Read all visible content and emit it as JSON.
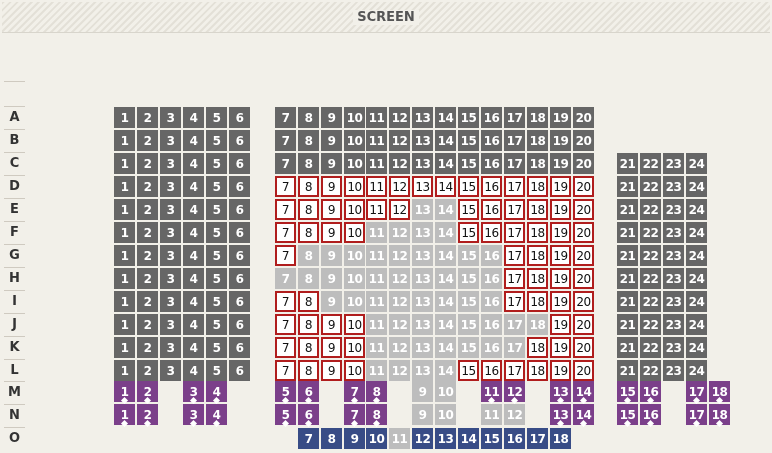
{
  "screen_label": "SCREEN",
  "row_labels": [
    "A",
    "B",
    "C",
    "D",
    "E",
    "F",
    "G",
    "H",
    "I",
    "J",
    "K",
    "L",
    "M",
    "N",
    "O"
  ],
  "legend_colors": {
    "taken": "#666666",
    "free_border": "#b01d1d",
    "blocked": "#bdbdbd",
    "special": "#7b3f8a",
    "blue": "#384c86"
  },
  "rows": [
    {
      "row": "A",
      "seats": [
        [
          "1",
          "taken"
        ],
        [
          "2",
          "taken"
        ],
        [
          "3",
          "taken"
        ],
        [
          "4",
          "taken"
        ],
        [
          "5",
          "taken"
        ],
        [
          "6",
          "taken"
        ],
        [
          "7",
          "taken"
        ],
        [
          "8",
          "taken"
        ],
        [
          "9",
          "taken"
        ],
        [
          "10",
          "taken"
        ],
        [
          "11",
          "taken"
        ],
        [
          "12",
          "taken"
        ],
        [
          "13",
          "taken"
        ],
        [
          "14",
          "taken"
        ],
        [
          "15",
          "taken"
        ],
        [
          "16",
          "taken"
        ],
        [
          "17",
          "taken"
        ],
        [
          "18",
          "taken"
        ],
        [
          "19",
          "taken"
        ],
        [
          "20",
          "taken"
        ]
      ]
    },
    {
      "row": "B",
      "seats": [
        [
          "1",
          "taken"
        ],
        [
          "2",
          "taken"
        ],
        [
          "3",
          "taken"
        ],
        [
          "4",
          "taken"
        ],
        [
          "5",
          "taken"
        ],
        [
          "6",
          "taken"
        ],
        [
          "7",
          "taken"
        ],
        [
          "8",
          "taken"
        ],
        [
          "9",
          "taken"
        ],
        [
          "10",
          "taken"
        ],
        [
          "11",
          "taken"
        ],
        [
          "12",
          "taken"
        ],
        [
          "13",
          "taken"
        ],
        [
          "14",
          "taken"
        ],
        [
          "15",
          "taken"
        ],
        [
          "16",
          "taken"
        ],
        [
          "17",
          "taken"
        ],
        [
          "18",
          "taken"
        ],
        [
          "19",
          "taken"
        ],
        [
          "20",
          "taken"
        ]
      ]
    },
    {
      "row": "C",
      "seats": [
        [
          "1",
          "taken"
        ],
        [
          "2",
          "taken"
        ],
        [
          "3",
          "taken"
        ],
        [
          "4",
          "taken"
        ],
        [
          "5",
          "taken"
        ],
        [
          "6",
          "taken"
        ],
        [
          "7",
          "taken"
        ],
        [
          "8",
          "taken"
        ],
        [
          "9",
          "taken"
        ],
        [
          "10",
          "taken"
        ],
        [
          "11",
          "taken"
        ],
        [
          "12",
          "taken"
        ],
        [
          "13",
          "taken"
        ],
        [
          "14",
          "taken"
        ],
        [
          "15",
          "taken"
        ],
        [
          "16",
          "taken"
        ],
        [
          "17",
          "taken"
        ],
        [
          "18",
          "taken"
        ],
        [
          "19",
          "taken"
        ],
        [
          "20",
          "taken"
        ],
        [
          "21",
          "taken"
        ],
        [
          "22",
          "taken"
        ],
        [
          "23",
          "taken"
        ],
        [
          "24",
          "taken"
        ]
      ]
    },
    {
      "row": "D",
      "seats": [
        [
          "1",
          "taken"
        ],
        [
          "2",
          "taken"
        ],
        [
          "3",
          "taken"
        ],
        [
          "4",
          "taken"
        ],
        [
          "5",
          "taken"
        ],
        [
          "6",
          "taken"
        ],
        [
          "7",
          "free"
        ],
        [
          "8",
          "free"
        ],
        [
          "9",
          "free"
        ],
        [
          "10",
          "free"
        ],
        [
          "11",
          "free"
        ],
        [
          "12",
          "free"
        ],
        [
          "13",
          "free"
        ],
        [
          "14",
          "free"
        ],
        [
          "15",
          "free"
        ],
        [
          "16",
          "free"
        ],
        [
          "17",
          "free"
        ],
        [
          "18",
          "free"
        ],
        [
          "19",
          "free"
        ],
        [
          "20",
          "free"
        ],
        [
          "21",
          "taken"
        ],
        [
          "22",
          "taken"
        ],
        [
          "23",
          "taken"
        ],
        [
          "24",
          "taken"
        ]
      ]
    },
    {
      "row": "E",
      "seats": [
        [
          "1",
          "taken"
        ],
        [
          "2",
          "taken"
        ],
        [
          "3",
          "taken"
        ],
        [
          "4",
          "taken"
        ],
        [
          "5",
          "taken"
        ],
        [
          "6",
          "taken"
        ],
        [
          "7",
          "free"
        ],
        [
          "8",
          "free"
        ],
        [
          "9",
          "free"
        ],
        [
          "10",
          "free"
        ],
        [
          "11",
          "free"
        ],
        [
          "12",
          "free"
        ],
        [
          "13",
          "blocked"
        ],
        [
          "14",
          "blocked"
        ],
        [
          "15",
          "free"
        ],
        [
          "16",
          "free"
        ],
        [
          "17",
          "free"
        ],
        [
          "18",
          "free"
        ],
        [
          "19",
          "free"
        ],
        [
          "20",
          "free"
        ],
        [
          "21",
          "taken"
        ],
        [
          "22",
          "taken"
        ],
        [
          "23",
          "taken"
        ],
        [
          "24",
          "taken"
        ]
      ]
    },
    {
      "row": "F",
      "seats": [
        [
          "1",
          "taken"
        ],
        [
          "2",
          "taken"
        ],
        [
          "3",
          "taken"
        ],
        [
          "4",
          "taken"
        ],
        [
          "5",
          "taken"
        ],
        [
          "6",
          "taken"
        ],
        [
          "7",
          "free"
        ],
        [
          "8",
          "free"
        ],
        [
          "9",
          "free"
        ],
        [
          "10",
          "free"
        ],
        [
          "11",
          "blocked"
        ],
        [
          "12",
          "blocked"
        ],
        [
          "13",
          "blocked"
        ],
        [
          "14",
          "blocked"
        ],
        [
          "15",
          "free"
        ],
        [
          "16",
          "free"
        ],
        [
          "17",
          "free"
        ],
        [
          "18",
          "free"
        ],
        [
          "19",
          "free"
        ],
        [
          "20",
          "free"
        ],
        [
          "21",
          "taken"
        ],
        [
          "22",
          "taken"
        ],
        [
          "23",
          "taken"
        ],
        [
          "24",
          "taken"
        ]
      ]
    },
    {
      "row": "G",
      "seats": [
        [
          "1",
          "taken"
        ],
        [
          "2",
          "taken"
        ],
        [
          "3",
          "taken"
        ],
        [
          "4",
          "taken"
        ],
        [
          "5",
          "taken"
        ],
        [
          "6",
          "taken"
        ],
        [
          "7",
          "free"
        ],
        [
          "8",
          "blocked"
        ],
        [
          "9",
          "blocked"
        ],
        [
          "10",
          "blocked"
        ],
        [
          "11",
          "blocked"
        ],
        [
          "12",
          "blocked"
        ],
        [
          "13",
          "blocked"
        ],
        [
          "14",
          "blocked"
        ],
        [
          "15",
          "blocked"
        ],
        [
          "16",
          "blocked"
        ],
        [
          "17",
          "free"
        ],
        [
          "18",
          "free"
        ],
        [
          "19",
          "free"
        ],
        [
          "20",
          "free"
        ],
        [
          "21",
          "taken"
        ],
        [
          "22",
          "taken"
        ],
        [
          "23",
          "taken"
        ],
        [
          "24",
          "taken"
        ]
      ]
    },
    {
      "row": "H",
      "seats": [
        [
          "1",
          "taken"
        ],
        [
          "2",
          "taken"
        ],
        [
          "3",
          "taken"
        ],
        [
          "4",
          "taken"
        ],
        [
          "5",
          "taken"
        ],
        [
          "6",
          "taken"
        ],
        [
          "7",
          "blocked"
        ],
        [
          "8",
          "blocked"
        ],
        [
          "9",
          "blocked"
        ],
        [
          "10",
          "blocked"
        ],
        [
          "11",
          "blocked"
        ],
        [
          "12",
          "blocked"
        ],
        [
          "13",
          "blocked"
        ],
        [
          "14",
          "blocked"
        ],
        [
          "15",
          "blocked"
        ],
        [
          "16",
          "blocked"
        ],
        [
          "17",
          "free"
        ],
        [
          "18",
          "free"
        ],
        [
          "19",
          "free"
        ],
        [
          "20",
          "free"
        ],
        [
          "21",
          "taken"
        ],
        [
          "22",
          "taken"
        ],
        [
          "23",
          "taken"
        ],
        [
          "24",
          "taken"
        ]
      ]
    },
    {
      "row": "I",
      "seats": [
        [
          "1",
          "taken"
        ],
        [
          "2",
          "taken"
        ],
        [
          "3",
          "taken"
        ],
        [
          "4",
          "taken"
        ],
        [
          "5",
          "taken"
        ],
        [
          "6",
          "taken"
        ],
        [
          "7",
          "free"
        ],
        [
          "8",
          "free"
        ],
        [
          "9",
          "blocked"
        ],
        [
          "10",
          "blocked"
        ],
        [
          "11",
          "blocked"
        ],
        [
          "12",
          "blocked"
        ],
        [
          "13",
          "blocked"
        ],
        [
          "14",
          "blocked"
        ],
        [
          "15",
          "blocked"
        ],
        [
          "16",
          "blocked"
        ],
        [
          "17",
          "free"
        ],
        [
          "18",
          "free"
        ],
        [
          "19",
          "free"
        ],
        [
          "20",
          "free"
        ],
        [
          "21",
          "taken"
        ],
        [
          "22",
          "taken"
        ],
        [
          "23",
          "taken"
        ],
        [
          "24",
          "taken"
        ]
      ]
    },
    {
      "row": "J",
      "seats": [
        [
          "1",
          "taken"
        ],
        [
          "2",
          "taken"
        ],
        [
          "3",
          "taken"
        ],
        [
          "4",
          "taken"
        ],
        [
          "5",
          "taken"
        ],
        [
          "6",
          "taken"
        ],
        [
          "7",
          "free"
        ],
        [
          "8",
          "free"
        ],
        [
          "9",
          "free"
        ],
        [
          "10",
          "free"
        ],
        [
          "11",
          "blocked"
        ],
        [
          "12",
          "blocked"
        ],
        [
          "13",
          "blocked"
        ],
        [
          "14",
          "blocked"
        ],
        [
          "15",
          "blocked"
        ],
        [
          "16",
          "blocked"
        ],
        [
          "17",
          "blocked"
        ],
        [
          "18",
          "blocked"
        ],
        [
          "19",
          "free"
        ],
        [
          "20",
          "free"
        ],
        [
          "21",
          "taken"
        ],
        [
          "22",
          "taken"
        ],
        [
          "23",
          "taken"
        ],
        [
          "24",
          "taken"
        ]
      ]
    },
    {
      "row": "K",
      "seats": [
        [
          "1",
          "taken"
        ],
        [
          "2",
          "taken"
        ],
        [
          "3",
          "taken"
        ],
        [
          "4",
          "taken"
        ],
        [
          "5",
          "taken"
        ],
        [
          "6",
          "taken"
        ],
        [
          "7",
          "free"
        ],
        [
          "8",
          "free"
        ],
        [
          "9",
          "free"
        ],
        [
          "10",
          "free"
        ],
        [
          "11",
          "blocked"
        ],
        [
          "12",
          "blocked"
        ],
        [
          "13",
          "blocked"
        ],
        [
          "14",
          "blocked"
        ],
        [
          "15",
          "blocked"
        ],
        [
          "16",
          "blocked"
        ],
        [
          "17",
          "blocked"
        ],
        [
          "18",
          "free"
        ],
        [
          "19",
          "free"
        ],
        [
          "20",
          "free"
        ],
        [
          "21",
          "taken"
        ],
        [
          "22",
          "taken"
        ],
        [
          "23",
          "taken"
        ],
        [
          "24",
          "taken"
        ]
      ]
    },
    {
      "row": "L",
      "seats": [
        [
          "1",
          "taken"
        ],
        [
          "2",
          "taken"
        ],
        [
          "3",
          "taken"
        ],
        [
          "4",
          "taken"
        ],
        [
          "5",
          "taken"
        ],
        [
          "6",
          "taken"
        ],
        [
          "7",
          "free"
        ],
        [
          "8",
          "free"
        ],
        [
          "9",
          "free"
        ],
        [
          "10",
          "free"
        ],
        [
          "11",
          "blocked"
        ],
        [
          "12",
          "blocked"
        ],
        [
          "13",
          "blocked"
        ],
        [
          "14",
          "blocked"
        ],
        [
          "15",
          "free"
        ],
        [
          "16",
          "free"
        ],
        [
          "17",
          "free"
        ],
        [
          "18",
          "free"
        ],
        [
          "19",
          "free"
        ],
        [
          "20",
          "free"
        ],
        [
          "21",
          "taken"
        ],
        [
          "22",
          "taken"
        ],
        [
          "23",
          "taken"
        ],
        [
          "24",
          "taken"
        ]
      ]
    },
    {
      "row": "M",
      "seats": [
        [
          "1",
          "special"
        ],
        [
          "2",
          "special"
        ],
        [
          "3",
          "special"
        ],
        [
          "4",
          "special"
        ],
        [
          "5",
          "special"
        ],
        [
          "6",
          "special"
        ],
        [
          "7",
          "special"
        ],
        [
          "8",
          "special"
        ],
        [
          "9",
          "blocked"
        ],
        [
          "10",
          "blocked"
        ],
        [
          "11",
          "special"
        ],
        [
          "12",
          "special"
        ],
        [
          "13",
          "special"
        ],
        [
          "14",
          "special"
        ],
        [
          "15",
          "special"
        ],
        [
          "16",
          "special"
        ],
        [
          "17",
          "special"
        ],
        [
          "18",
          "special"
        ]
      ]
    },
    {
      "row": "N",
      "seats": [
        [
          "1",
          "special"
        ],
        [
          "2",
          "special"
        ],
        [
          "3",
          "special"
        ],
        [
          "4",
          "special"
        ],
        [
          "5",
          "special"
        ],
        [
          "6",
          "special"
        ],
        [
          "7",
          "special"
        ],
        [
          "8",
          "special"
        ],
        [
          "9",
          "blocked"
        ],
        [
          "10",
          "blocked"
        ],
        [
          "11",
          "blocked"
        ],
        [
          "12",
          "blocked"
        ],
        [
          "13",
          "special"
        ],
        [
          "14",
          "special"
        ],
        [
          "15",
          "special"
        ],
        [
          "16",
          "special"
        ],
        [
          "17",
          "special"
        ],
        [
          "18",
          "special"
        ]
      ]
    },
    {
      "row": "O",
      "seats": [
        [
          "7",
          "blue"
        ],
        [
          "8",
          "blue"
        ],
        [
          "9",
          "blue"
        ],
        [
          "10",
          "blue"
        ],
        [
          "11",
          "blocked"
        ],
        [
          "12",
          "blue"
        ],
        [
          "13",
          "blue"
        ],
        [
          "14",
          "blue"
        ],
        [
          "15",
          "blue"
        ],
        [
          "16",
          "blue"
        ],
        [
          "17",
          "blue"
        ],
        [
          "18",
          "blue"
        ]
      ]
    }
  ]
}
